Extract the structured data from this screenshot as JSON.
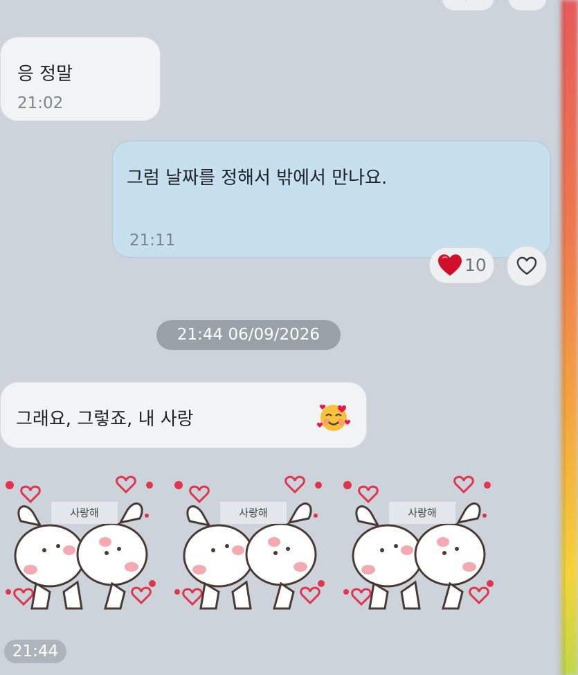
{
  "messages": [
    {
      "text": "응 정말",
      "time": "21:02"
    },
    {
      "text": "그럼 날짜를 정해서 밖에서 만나요.",
      "time": "21:11"
    },
    {
      "text": "그래요, 그렇죠, 내 사랑",
      "emoji": "smiling-face-with-hearts"
    }
  ],
  "reaction": {
    "icon": "red-heart",
    "count": "10"
  },
  "date_separator": "21:44 06/09/2026",
  "stickers": [
    {
      "caption": "사랑해"
    },
    {
      "caption": "사랑해"
    },
    {
      "caption": "사랑해"
    }
  ],
  "sticker_time": "21:44",
  "colors": {
    "incoming_bubble": "#f2f3f5",
    "outgoing_bubble": "#c7e0ee",
    "background": "#cdd3db",
    "heart": "#d0102a"
  }
}
